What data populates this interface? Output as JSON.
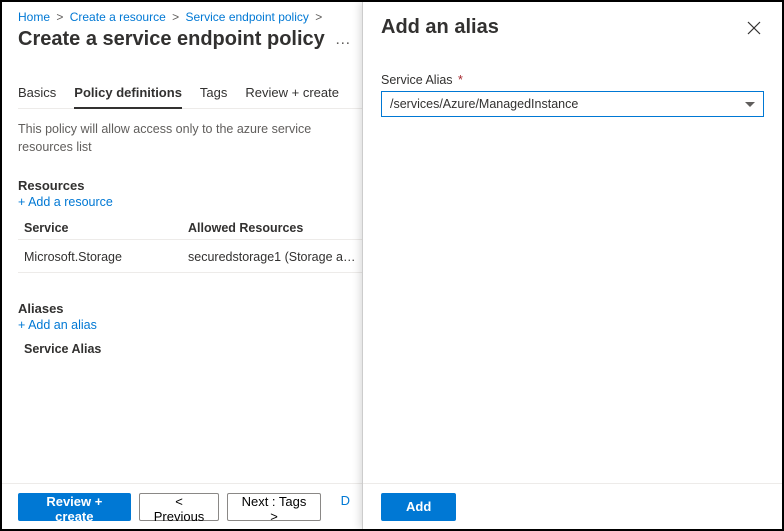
{
  "breadcrumbs": {
    "home": "Home",
    "create_resource": "Create a resource",
    "service_endpoint_policy": "Service endpoint policy",
    "sep": ">"
  },
  "page_title": "Create a service endpoint policy",
  "more_indicator": "…",
  "tabs": {
    "basics": "Basics",
    "policy_definitions": "Policy definitions",
    "tags": "Tags",
    "review_create": "Review + create"
  },
  "description": "This policy will allow access only to the azure service resources list",
  "resources": {
    "heading": "Resources",
    "add_link": "+ Add a resource",
    "col_service": "Service",
    "col_allowed": "Allowed Resources",
    "rows": [
      {
        "service": "Microsoft.Storage",
        "allowed": "securedstorage1 (Storage a…"
      }
    ]
  },
  "aliases": {
    "heading": "Aliases",
    "add_link": "+ Add an alias",
    "col_alias": "Service Alias"
  },
  "footer": {
    "review_create": "Review + create",
    "previous": "< Previous",
    "next": "Next : Tags >",
    "download_partial": "D"
  },
  "panel": {
    "title": "Add an alias",
    "field_label": "Service Alias",
    "required_mark": "*",
    "value": "/services/Azure/ManagedInstance",
    "add_button": "Add"
  }
}
